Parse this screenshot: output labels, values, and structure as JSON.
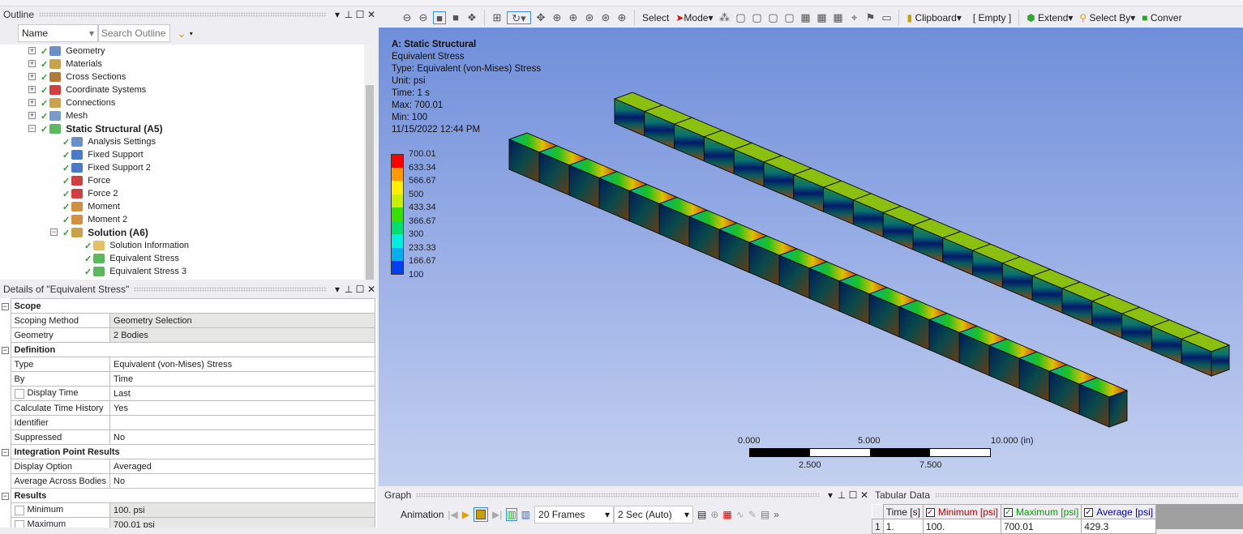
{
  "outline": {
    "title": "Outline",
    "filter_value": "Name",
    "search_placeholder": "Search Outline",
    "items": [
      {
        "label": "Geometry",
        "level": 1,
        "bold": false,
        "color": "#6a8fc9"
      },
      {
        "label": "Materials",
        "level": 1,
        "bold": false,
        "color": "#c9a24a"
      },
      {
        "label": "Cross Sections",
        "level": 1,
        "bold": false,
        "color": "#b07a3a"
      },
      {
        "label": "Coordinate Systems",
        "level": 1,
        "bold": false,
        "color": "#d04040"
      },
      {
        "label": "Connections",
        "level": 1,
        "bold": false,
        "color": "#c9a24a"
      },
      {
        "label": "Mesh",
        "level": 1,
        "bold": false,
        "color": "#7a9ac9"
      },
      {
        "label": "Static Structural (A5)",
        "level": 1,
        "bold": true,
        "color": "#5cb85c"
      },
      {
        "label": "Analysis Settings",
        "level": 2,
        "bold": false,
        "color": "#6a8fc9"
      },
      {
        "label": "Fixed Support",
        "level": 2,
        "bold": false,
        "color": "#4a7ac9"
      },
      {
        "label": "Fixed Support 2",
        "level": 2,
        "bold": false,
        "color": "#4a7ac9"
      },
      {
        "label": "Force",
        "level": 2,
        "bold": false,
        "color": "#d04040"
      },
      {
        "label": "Force 2",
        "level": 2,
        "bold": false,
        "color": "#d04040"
      },
      {
        "label": "Moment",
        "level": 2,
        "bold": false,
        "color": "#d09040"
      },
      {
        "label": "Moment 2",
        "level": 2,
        "bold": false,
        "color": "#d09040"
      },
      {
        "label": "Solution (A6)",
        "level": 2,
        "bold": true,
        "color": "#c9a24a"
      },
      {
        "label": "Solution Information",
        "level": 3,
        "bold": false,
        "color": "#e0c060"
      },
      {
        "label": "Equivalent Stress",
        "level": 3,
        "bold": false,
        "color": "#5cb85c"
      },
      {
        "label": "Equivalent Stress 3",
        "level": 3,
        "bold": false,
        "color": "#5cb85c"
      }
    ]
  },
  "details": {
    "title": "Details of \"Equivalent Stress\"",
    "sections": [
      {
        "name": "Scope",
        "rows": [
          {
            "k": "Scoping Method",
            "v": "Geometry Selection",
            "gray": true
          },
          {
            "k": "Geometry",
            "v": "2 Bodies",
            "gray": true
          }
        ]
      },
      {
        "name": "Definition",
        "rows": [
          {
            "k": "Type",
            "v": "Equivalent (von-Mises) Stress"
          },
          {
            "k": "By",
            "v": "Time"
          },
          {
            "k": "Display Time",
            "v": "Last",
            "cb": true
          },
          {
            "k": "Calculate Time History",
            "v": "Yes"
          },
          {
            "k": "Identifier",
            "v": ""
          },
          {
            "k": "Suppressed",
            "v": "No"
          }
        ]
      },
      {
        "name": "Integration Point Results",
        "rows": [
          {
            "k": "Display Option",
            "v": "Averaged"
          },
          {
            "k": "Average Across Bodies",
            "v": "No"
          }
        ]
      },
      {
        "name": "Results",
        "rows": [
          {
            "k": "Minimum",
            "v": "100. psi",
            "cb": true,
            "gray": true
          },
          {
            "k": "Maximum",
            "v": "700.01 psi",
            "cb": true,
            "gray": true
          }
        ]
      }
    ]
  },
  "toolbar": {
    "select": "Select",
    "mode": "Mode",
    "clipboard": "Clipboard",
    "empty": "[ Empty ]",
    "extend": "Extend",
    "select_by": "Select By",
    "convert": "Conver"
  },
  "viewport": {
    "info": [
      "A: Static Structural",
      "Equivalent Stress",
      "Type: Equivalent (von-Mises) Stress",
      "Unit: psi",
      "Time: 1 s",
      "Max: 700.01",
      "Min: 100",
      "11/15/2022 12:44 PM"
    ],
    "legend": {
      "labels": [
        "700.01",
        "633.34",
        "566.67",
        "500",
        "433.34",
        "366.67",
        "300",
        "233.33",
        "166.67",
        "100"
      ],
      "colors": [
        "#ff0000",
        "#ff9a00",
        "#ffee00",
        "#c8f000",
        "#38e000",
        "#00e070",
        "#00f0e0",
        "#00b0f0",
        "#0040f0"
      ]
    },
    "scale": {
      "top": [
        "0.000",
        "5.000",
        "10.000 (in)"
      ],
      "bottom": [
        "2.500",
        "7.500"
      ]
    }
  },
  "graph": {
    "title": "Graph",
    "animation": "Animation",
    "frames": "20 Frames",
    "duration": "2 Sec (Auto)"
  },
  "tabular": {
    "title": "Tabular Data",
    "headers": [
      "Time [s]",
      "Minimum [psi]",
      "Maximum [psi]",
      "Average [psi]"
    ],
    "header_colors": [
      "#222",
      "#c00000",
      "#00a000",
      "#0000c0"
    ],
    "row": [
      "1",
      "1.",
      "100.",
      "700.01",
      "429.3"
    ]
  }
}
